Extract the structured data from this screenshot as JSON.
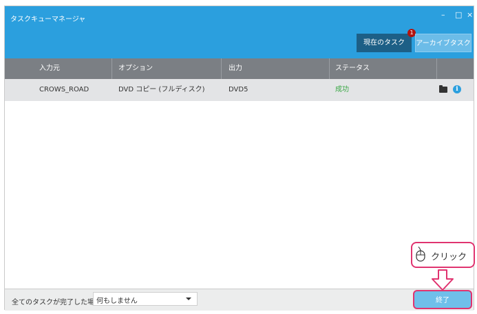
{
  "window": {
    "title": "タスクキューマネージャ",
    "controls": {
      "minimize": "–",
      "maximize": "□",
      "close": "×"
    },
    "accent_color": "#2b9fde"
  },
  "tabs": {
    "current": "現在のタスク",
    "current_badge": "1",
    "archive": "アーカイブタスク"
  },
  "table": {
    "headers": [
      "入力元",
      "オプション",
      "出力",
      "ステータス"
    ],
    "rows": [
      {
        "source": "CROWS_ROAD",
        "option": "DVD コピー (フルディスク)",
        "output": "DVD5",
        "status": "成功",
        "status_color": "#3aa845"
      }
    ]
  },
  "footer": {
    "label": "全てのタスクが完了した場合:",
    "select_value": "何もしません",
    "exit_button": "終了"
  },
  "annotation": {
    "callout_text": "クリック",
    "highlight_color": "#e0336f"
  }
}
